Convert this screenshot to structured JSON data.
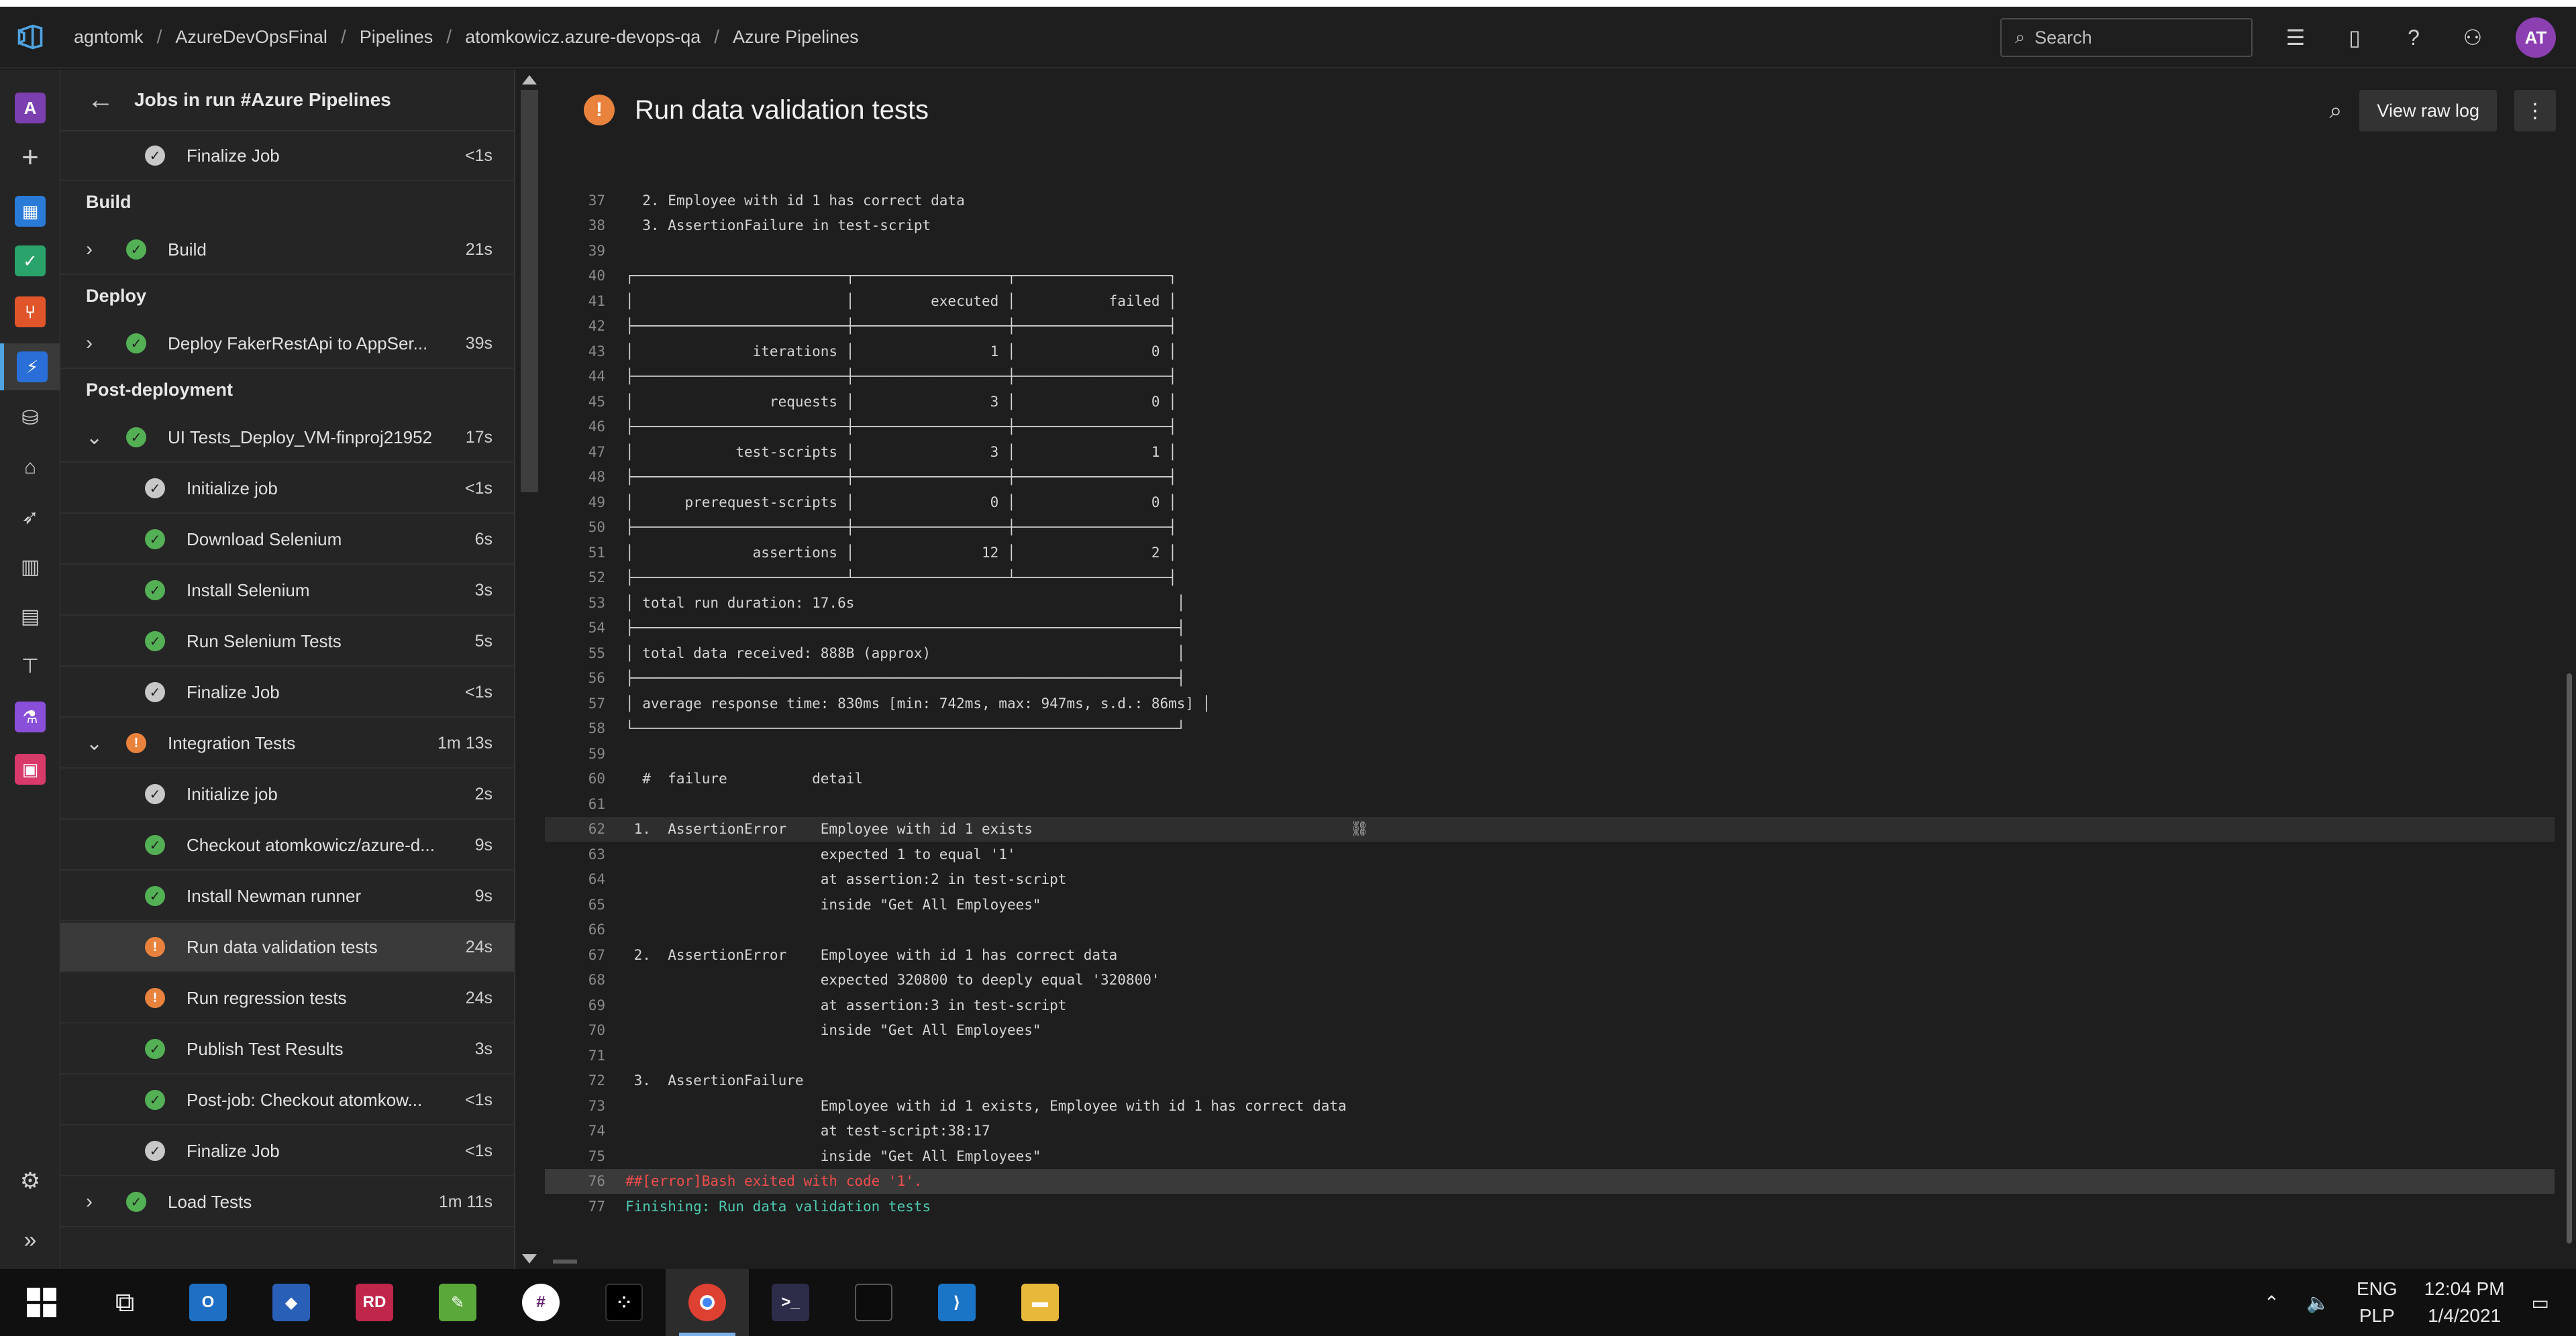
{
  "breadcrumbs": [
    "agntomk",
    "AzureDevOpsFinal",
    "Pipelines",
    "atomkowicz.azure-devops-qa",
    "Azure Pipelines"
  ],
  "search": {
    "placeholder": "Search"
  },
  "user": {
    "initials": "AT"
  },
  "rail_badge": "A",
  "jobs_panel": {
    "title": "Jobs in run #Azure Pipelines",
    "rows": [
      {
        "kind": "step",
        "label": "Finalize Job",
        "time": "<1s",
        "status": "skip"
      },
      {
        "kind": "stage",
        "label": "Build"
      },
      {
        "kind": "job",
        "label": "Build",
        "time": "21s",
        "status": "success",
        "expanded": false
      },
      {
        "kind": "stage",
        "label": "Deploy"
      },
      {
        "kind": "job",
        "label": "Deploy FakerRestApi to AppSer...",
        "time": "39s",
        "status": "success",
        "expanded": false
      },
      {
        "kind": "stage",
        "label": "Post-deployment"
      },
      {
        "kind": "job",
        "label": "UI Tests_Deploy_VM-finproj21952",
        "time": "17s",
        "status": "success",
        "expanded": true
      },
      {
        "kind": "step",
        "label": "Initialize job",
        "time": "<1s",
        "status": "skip"
      },
      {
        "kind": "step",
        "label": "Download Selenium",
        "time": "6s",
        "status": "success"
      },
      {
        "kind": "step",
        "label": "Install Selenium",
        "time": "3s",
        "status": "success"
      },
      {
        "kind": "step",
        "label": "Run Selenium Tests",
        "time": "5s",
        "status": "success"
      },
      {
        "kind": "step",
        "label": "Finalize Job",
        "time": "<1s",
        "status": "skip"
      },
      {
        "kind": "job",
        "label": "Integration Tests",
        "time": "1m 13s",
        "status": "warn",
        "expanded": true
      },
      {
        "kind": "step",
        "label": "Initialize job",
        "time": "2s",
        "status": "skip"
      },
      {
        "kind": "step",
        "label": "Checkout atomkowicz/azure-d...",
        "time": "9s",
        "status": "success"
      },
      {
        "kind": "step",
        "label": "Install Newman runner",
        "time": "9s",
        "status": "success"
      },
      {
        "kind": "step",
        "label": "Run data validation tests",
        "time": "24s",
        "status": "warn",
        "selected": true
      },
      {
        "kind": "step",
        "label": "Run regression tests",
        "time": "24s",
        "status": "warn"
      },
      {
        "kind": "step",
        "label": "Publish Test Results",
        "time": "3s",
        "status": "success"
      },
      {
        "kind": "step",
        "label": "Post-job: Checkout atomkow...",
        "time": "<1s",
        "status": "success"
      },
      {
        "kind": "step",
        "label": "Finalize Job",
        "time": "<1s",
        "status": "skip"
      },
      {
        "kind": "job",
        "label": "Load Tests",
        "time": "1m 11s",
        "status": "success",
        "expanded": false
      }
    ]
  },
  "log": {
    "title": "Run data validation tests",
    "view_raw_label": "View raw log",
    "lines": [
      {
        "n": "37",
        "t": "  2. Employee with id 1 has correct data"
      },
      {
        "n": "38",
        "t": "  3. AssertionFailure in test-script"
      },
      {
        "n": "39",
        "t": ""
      },
      {
        "n": "40",
        "t": "┌─────────────────────────┬──────────────────┬──────────────────┐"
      },
      {
        "n": "41",
        "t": "│                         │         executed │           failed │"
      },
      {
        "n": "42",
        "t": "├─────────────────────────┼──────────────────┼──────────────────┤"
      },
      {
        "n": "43",
        "t": "│              iterations │                1 │                0 │"
      },
      {
        "n": "44",
        "t": "├─────────────────────────┼──────────────────┼──────────────────┤"
      },
      {
        "n": "45",
        "t": "│                requests │                3 │                0 │"
      },
      {
        "n": "46",
        "t": "├─────────────────────────┼──────────────────┼──────────────────┤"
      },
      {
        "n": "47",
        "t": "│            test-scripts │                3 │                1 │"
      },
      {
        "n": "48",
        "t": "├─────────────────────────┼──────────────────┼──────────────────┤"
      },
      {
        "n": "49",
        "t": "│      prerequest-scripts │                0 │                0 │"
      },
      {
        "n": "50",
        "t": "├─────────────────────────┼──────────────────┼──────────────────┤"
      },
      {
        "n": "51",
        "t": "│              assertions │               12 │                2 │"
      },
      {
        "n": "52",
        "t": "├─────────────────────────┴──────────────────┴──────────────────┤"
      },
      {
        "n": "53",
        "t": "│ total run duration: 17.6s                                      │"
      },
      {
        "n": "54",
        "t": "├────────────────────────────────────────────────────────────────┤"
      },
      {
        "n": "55",
        "t": "│ total data received: 888B (approx)                             │"
      },
      {
        "n": "56",
        "t": "├────────────────────────────────────────────────────────────────┤"
      },
      {
        "n": "57",
        "t": "│ average response time: 830ms [min: 742ms, max: 947ms, s.d.: 86ms] │"
      },
      {
        "n": "58",
        "t": "└────────────────────────────────────────────────────────────────┘"
      },
      {
        "n": "59",
        "t": ""
      },
      {
        "n": "60",
        "t": "  #  failure          detail"
      },
      {
        "n": "61",
        "t": ""
      },
      {
        "n": "62",
        "t": " 1.  AssertionError    Employee with id 1 exists",
        "hl": true,
        "link": true
      },
      {
        "n": "63",
        "t": "                       expected 1 to equal '1'"
      },
      {
        "n": "64",
        "t": "                       at assertion:2 in test-script"
      },
      {
        "n": "65",
        "t": "                       inside \"Get All Employees\""
      },
      {
        "n": "66",
        "t": ""
      },
      {
        "n": "67",
        "t": " 2.  AssertionError    Employee with id 1 has correct data"
      },
      {
        "n": "68",
        "t": "                       expected 320800 to deeply equal '320800'"
      },
      {
        "n": "69",
        "t": "                       at assertion:3 in test-script"
      },
      {
        "n": "70",
        "t": "                       inside \"Get All Employees\""
      },
      {
        "n": "71",
        "t": ""
      },
      {
        "n": "72",
        "t": " 3.  AssertionFailure"
      },
      {
        "n": "73",
        "t": "                       Employee with id 1 exists, Employee with id 1 has correct data"
      },
      {
        "n": "74",
        "t": "                       at test-script:38:17"
      },
      {
        "n": "75",
        "t": "                       inside \"Get All Employees\""
      },
      {
        "n": "76",
        "t": "##[error]Bash exited with code '1'.",
        "err": true
      },
      {
        "n": "77",
        "t": "Finishing: Run data validation tests",
        "ok": true
      }
    ]
  },
  "taskbar": {
    "lang": "ENG",
    "layout": "PLP",
    "time": "12:04 PM",
    "date": "1/4/2021"
  },
  "colors": {
    "success": "#54b054",
    "warning": "#e8823c",
    "error_text": "#f14c4c",
    "finish_text": "#4ec9b0",
    "accent": "#4fa3e0"
  }
}
